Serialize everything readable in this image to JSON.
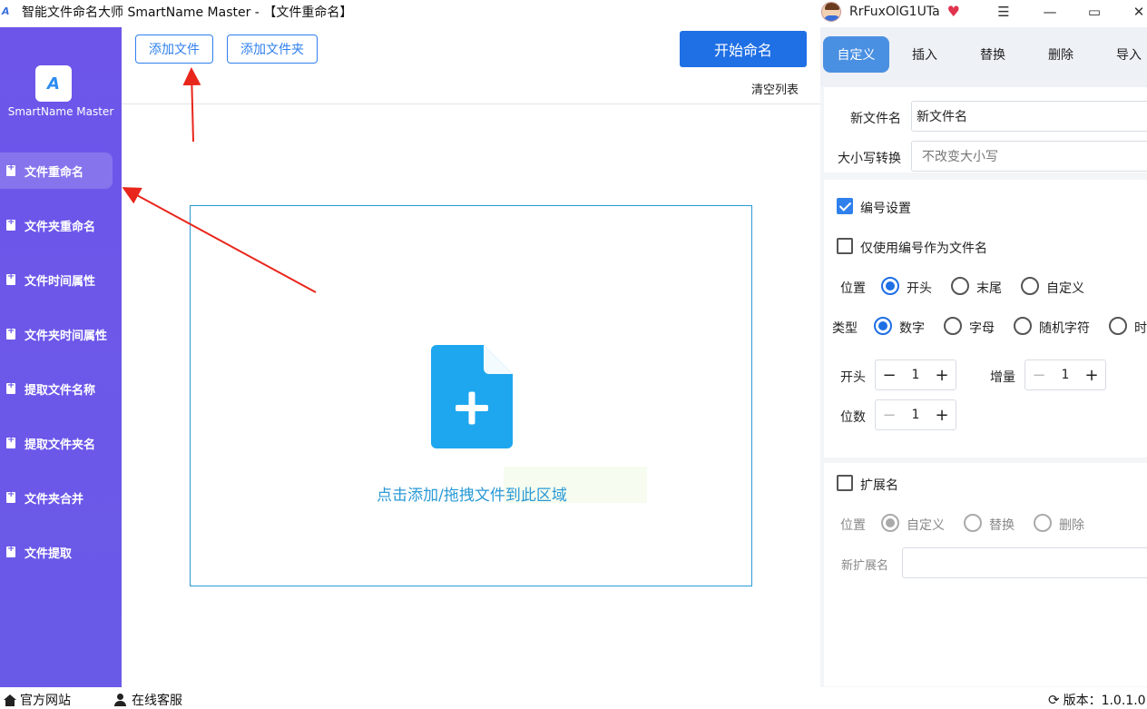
{
  "window": {
    "title": "智能文件命名大师 SmartName Master - 【文件重命名】",
    "app_icon": "A",
    "username": "RrFuxOlG1UTa",
    "vip_icon": "vip-heart-icon",
    "minimize_icon": "minimize-icon",
    "maximize_icon": "maximize-icon",
    "close_icon": "close-icon"
  },
  "sidebar": {
    "logo_text": "A",
    "brand": "SmartName Master",
    "items": [
      {
        "label": "文件重命名",
        "active": true
      },
      {
        "label": "文件夹重命名"
      },
      {
        "label": "文件时间属性"
      },
      {
        "label": "文件夹时间属性"
      },
      {
        "label": "提取文件名称"
      },
      {
        "label": "提取文件夹名"
      },
      {
        "label": "文件夹合并"
      },
      {
        "label": "文件提取"
      }
    ]
  },
  "toolbar": {
    "add_file": "添加文件",
    "add_folder": "添加文件夹",
    "start": "开始命名",
    "clear_list": "清空列表"
  },
  "dropzone": {
    "hint": "点击添加/拖拽文件到此区域",
    "icon": "add-file-icon"
  },
  "right_panel": {
    "tabs": [
      {
        "label": "自定义",
        "active": true
      },
      {
        "label": "插入"
      },
      {
        "label": "替换"
      },
      {
        "label": "删除"
      },
      {
        "label": "导入"
      }
    ],
    "new_name_label": "新文件名",
    "new_name_value": "新文件名",
    "case_label": "大小写转换",
    "case_value": "不改变大小写",
    "numbering": {
      "label": "编号设置",
      "checked": true,
      "only_number_label": "仅使用编号作为文件名",
      "only_number_checked": false,
      "position_label": "位置",
      "position_options": [
        "开头",
        "末尾",
        "自定义"
      ],
      "position_selected": "开头",
      "type_label": "类型",
      "type_options": [
        "数字",
        "字母",
        "随机字符",
        "时"
      ],
      "type_selected": "数字",
      "start_label": "开头",
      "start_value": "1",
      "increment_label": "增量",
      "increment_value": "1",
      "digits_label": "位数",
      "digits_value": "1"
    },
    "extension": {
      "label": "扩展名",
      "checked": false,
      "position_label": "位置",
      "options": [
        "自定义",
        "替换",
        "删除"
      ],
      "selected": "自定义",
      "new_ext_label": "新扩展名",
      "new_ext_value": ""
    }
  },
  "bottombar": {
    "website": "官方网站",
    "support": "在线客服",
    "version": "版本：1.0.1.0"
  },
  "colors": {
    "sidebar": "#6a5ae8",
    "primary": "#1f6fe5",
    "link_blue": "#2f80ed",
    "dropzone_hint": "#2a9ad6",
    "annotation_arrow": "#e8261c"
  }
}
